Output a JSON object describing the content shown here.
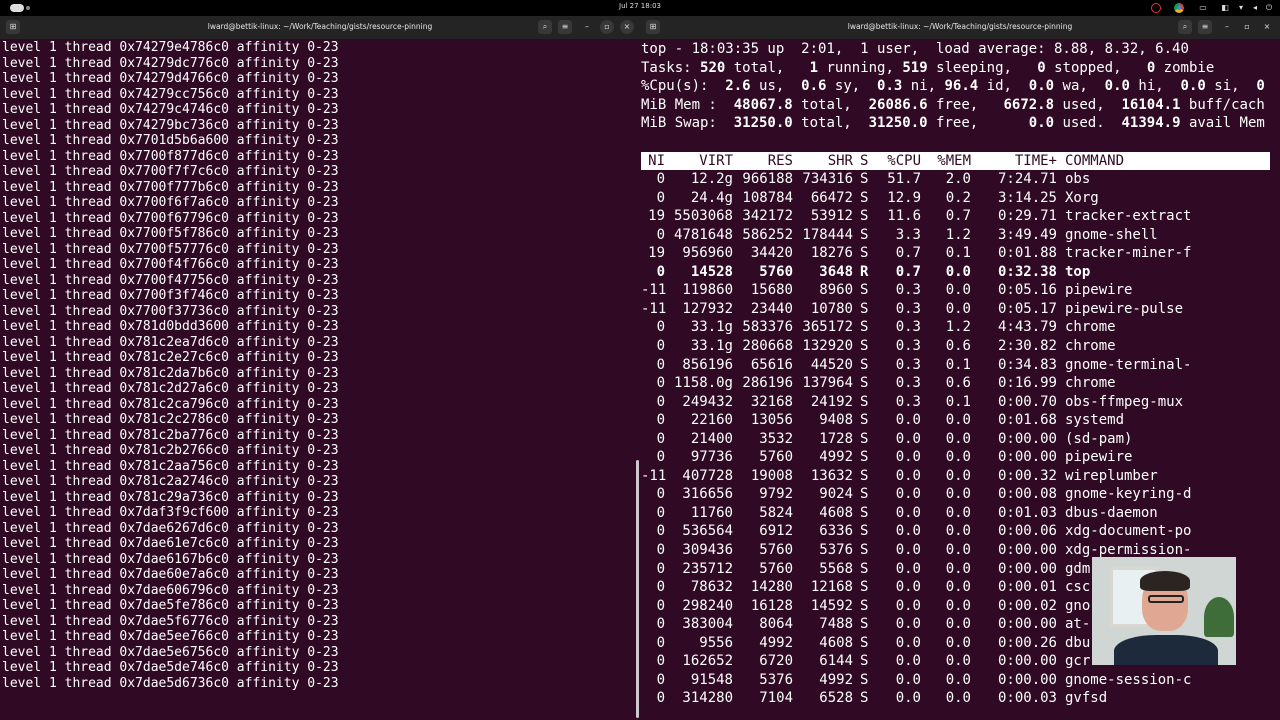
{
  "topbar": {
    "clock": "Jul 27  18:03"
  },
  "left_window": {
    "title": "lward@bettik-linux: ~/Work/Teaching/gists/resource-pinning",
    "lines": [
      "level 1 thread 0x74279e4786c0 affinity 0-23",
      "level 1 thread 0x74279dc776c0 affinity 0-23",
      "level 1 thread 0x74279d4766c0 affinity 0-23",
      "level 1 thread 0x74279cc756c0 affinity 0-23",
      "level 1 thread 0x74279c4746c0 affinity 0-23",
      "level 1 thread 0x74279bc736c0 affinity 0-23",
      "level 1 thread 0x7701d5b6a600 affinity 0-23",
      "level 1 thread 0x7700f877d6c0 affinity 0-23",
      "level 1 thread 0x7700f7f7c6c0 affinity 0-23",
      "level 1 thread 0x7700f777b6c0 affinity 0-23",
      "level 1 thread 0x7700f6f7a6c0 affinity 0-23",
      "level 1 thread 0x7700f67796c0 affinity 0-23",
      "level 1 thread 0x7700f5f786c0 affinity 0-23",
      "level 1 thread 0x7700f57776c0 affinity 0-23",
      "level 1 thread 0x7700f4f766c0 affinity 0-23",
      "level 1 thread 0x7700f47756c0 affinity 0-23",
      "level 1 thread 0x7700f3f746c0 affinity 0-23",
      "level 1 thread 0x7700f37736c0 affinity 0-23",
      "level 1 thread 0x781d0bdd3600 affinity 0-23",
      "level 1 thread 0x781c2ea7d6c0 affinity 0-23",
      "level 1 thread 0x781c2e27c6c0 affinity 0-23",
      "level 1 thread 0x781c2da7b6c0 affinity 0-23",
      "level 1 thread 0x781c2d27a6c0 affinity 0-23",
      "level 1 thread 0x781c2ca796c0 affinity 0-23",
      "level 1 thread 0x781c2c2786c0 affinity 0-23",
      "level 1 thread 0x781c2ba776c0 affinity 0-23",
      "level 1 thread 0x781c2b2766c0 affinity 0-23",
      "level 1 thread 0x781c2aa756c0 affinity 0-23",
      "level 1 thread 0x781c2a2746c0 affinity 0-23",
      "level 1 thread 0x781c29a736c0 affinity 0-23",
      "level 1 thread 0x7daf3f9cf600 affinity 0-23",
      "level 1 thread 0x7dae6267d6c0 affinity 0-23",
      "level 1 thread 0x7dae61e7c6c0 affinity 0-23",
      "level 1 thread 0x7dae6167b6c0 affinity 0-23",
      "level 1 thread 0x7dae60e7a6c0 affinity 0-23",
      "level 1 thread 0x7dae606796c0 affinity 0-23",
      "level 1 thread 0x7dae5fe786c0 affinity 0-23",
      "level 1 thread 0x7dae5f6776c0 affinity 0-23",
      "level 1 thread 0x7dae5ee766c0 affinity 0-23",
      "level 1 thread 0x7dae5e6756c0 affinity 0-23",
      "level 1 thread 0x7dae5de746c0 affinity 0-23",
      "level 1 thread 0x7dae5d6736c0 affinity 0-23"
    ]
  },
  "right_window": {
    "title": "lward@bettik-linux: ~/Work/Teaching/gists/resource-pinning",
    "summary": [
      [
        {
          "t": "top - 18:03:35 up  2:01,  1 user,  load average: 8.88, 8.32, 6.40",
          "b": false
        }
      ],
      [
        {
          "t": "Tasks: ",
          "b": false
        },
        {
          "t": "520",
          "b": true
        },
        {
          "t": " total,   ",
          "b": false
        },
        {
          "t": "1",
          "b": true
        },
        {
          "t": " running, ",
          "b": false
        },
        {
          "t": "519",
          "b": true
        },
        {
          "t": " sleeping,   ",
          "b": false
        },
        {
          "t": "0",
          "b": true
        },
        {
          "t": " stopped,   ",
          "b": false
        },
        {
          "t": "0",
          "b": true
        },
        {
          "t": " zombie",
          "b": false
        }
      ],
      [
        {
          "t": "%Cpu(s):  ",
          "b": false
        },
        {
          "t": "2.6",
          "b": true
        },
        {
          "t": " us,  ",
          "b": false
        },
        {
          "t": "0.6",
          "b": true
        },
        {
          "t": " sy,  ",
          "b": false
        },
        {
          "t": "0.3",
          "b": true
        },
        {
          "t": " ni, ",
          "b": false
        },
        {
          "t": "96.4",
          "b": true
        },
        {
          "t": " id,  ",
          "b": false
        },
        {
          "t": "0.0",
          "b": true
        },
        {
          "t": " wa,  ",
          "b": false
        },
        {
          "t": "0.0",
          "b": true
        },
        {
          "t": " hi,  ",
          "b": false
        },
        {
          "t": "0.0",
          "b": true
        },
        {
          "t": " si,  ",
          "b": false
        },
        {
          "t": "0",
          "b": true
        }
      ],
      [
        {
          "t": "MiB Mem :  ",
          "b": false
        },
        {
          "t": "48067.8",
          "b": true
        },
        {
          "t": " total,  ",
          "b": false
        },
        {
          "t": "26086.6",
          "b": true
        },
        {
          "t": " free,   ",
          "b": false
        },
        {
          "t": "6672.8",
          "b": true
        },
        {
          "t": " used,  ",
          "b": false
        },
        {
          "t": "16104.1",
          "b": true
        },
        {
          "t": " buff/cach",
          "b": false
        }
      ],
      [
        {
          "t": "MiB Swap:  ",
          "b": false
        },
        {
          "t": "31250.0",
          "b": true
        },
        {
          "t": " total,  ",
          "b": false
        },
        {
          "t": "31250.0",
          "b": true
        },
        {
          "t": " free,      ",
          "b": false
        },
        {
          "t": "0.0",
          "b": true
        },
        {
          "t": " used.  ",
          "b": false
        },
        {
          "t": "41394.9",
          "b": true
        },
        {
          "t": " avail Mem",
          "b": false
        }
      ]
    ],
    "columns": {
      "ni": "NI",
      "virt": "VIRT",
      "res": "RES",
      "shr": "SHR",
      "s": "S",
      "cpu": "%CPU",
      "mem": "%MEM",
      "time": "TIME+",
      "cmd": "COMMAND"
    },
    "processes": [
      {
        "ni": "0",
        "virt": "12.2g",
        "res": "966188",
        "shr": "734316",
        "s": "S",
        "cpu": "51.7",
        "mem": "2.0",
        "time": "7:24.71",
        "cmd": "obs"
      },
      {
        "ni": "0",
        "virt": "24.4g",
        "res": "108784",
        "shr": "66472",
        "s": "S",
        "cpu": "12.9",
        "mem": "0.2",
        "time": "3:14.25",
        "cmd": "Xorg"
      },
      {
        "ni": "19",
        "virt": "5503068",
        "res": "342172",
        "shr": "53912",
        "s": "S",
        "cpu": "11.6",
        "mem": "0.7",
        "time": "0:29.71",
        "cmd": "tracker-extract"
      },
      {
        "ni": "0",
        "virt": "4781648",
        "res": "586252",
        "shr": "178444",
        "s": "S",
        "cpu": "3.3",
        "mem": "1.2",
        "time": "3:49.49",
        "cmd": "gnome-shell"
      },
      {
        "ni": "19",
        "virt": "956960",
        "res": "34420",
        "shr": "18276",
        "s": "S",
        "cpu": "0.7",
        "mem": "0.1",
        "time": "0:01.88",
        "cmd": "tracker-miner-f"
      },
      {
        "ni": "0",
        "virt": "14528",
        "res": "5760",
        "shr": "3648",
        "s": "R",
        "cpu": "0.7",
        "mem": "0.0",
        "time": "0:32.38",
        "cmd": "top",
        "bold": true
      },
      {
        "ni": "-11",
        "virt": "119860",
        "res": "15680",
        "shr": "8960",
        "s": "S",
        "cpu": "0.3",
        "mem": "0.0",
        "time": "0:05.16",
        "cmd": "pipewire"
      },
      {
        "ni": "-11",
        "virt": "127932",
        "res": "23440",
        "shr": "10780",
        "s": "S",
        "cpu": "0.3",
        "mem": "0.0",
        "time": "0:05.17",
        "cmd": "pipewire-pulse"
      },
      {
        "ni": "0",
        "virt": "33.1g",
        "res": "583376",
        "shr": "365172",
        "s": "S",
        "cpu": "0.3",
        "mem": "1.2",
        "time": "4:43.79",
        "cmd": "chrome"
      },
      {
        "ni": "0",
        "virt": "33.1g",
        "res": "280668",
        "shr": "132920",
        "s": "S",
        "cpu": "0.3",
        "mem": "0.6",
        "time": "2:30.82",
        "cmd": "chrome"
      },
      {
        "ni": "0",
        "virt": "856196",
        "res": "65616",
        "shr": "44520",
        "s": "S",
        "cpu": "0.3",
        "mem": "0.1",
        "time": "0:34.83",
        "cmd": "gnome-terminal-"
      },
      {
        "ni": "0",
        "virt": "1158.0g",
        "res": "286196",
        "shr": "137964",
        "s": "S",
        "cpu": "0.3",
        "mem": "0.6",
        "time": "0:16.99",
        "cmd": "chrome"
      },
      {
        "ni": "0",
        "virt": "249432",
        "res": "32168",
        "shr": "24192",
        "s": "S",
        "cpu": "0.3",
        "mem": "0.1",
        "time": "0:00.70",
        "cmd": "obs-ffmpeg-mux"
      },
      {
        "ni": "0",
        "virt": "22160",
        "res": "13056",
        "shr": "9408",
        "s": "S",
        "cpu": "0.0",
        "mem": "0.0",
        "time": "0:01.68",
        "cmd": "systemd"
      },
      {
        "ni": "0",
        "virt": "21400",
        "res": "3532",
        "shr": "1728",
        "s": "S",
        "cpu": "0.0",
        "mem": "0.0",
        "time": "0:00.00",
        "cmd": "(sd-pam)"
      },
      {
        "ni": "0",
        "virt": "97736",
        "res": "5760",
        "shr": "4992",
        "s": "S",
        "cpu": "0.0",
        "mem": "0.0",
        "time": "0:00.00",
        "cmd": "pipewire"
      },
      {
        "ni": "-11",
        "virt": "407728",
        "res": "19008",
        "shr": "13632",
        "s": "S",
        "cpu": "0.0",
        "mem": "0.0",
        "time": "0:00.32",
        "cmd": "wireplumber"
      },
      {
        "ni": "0",
        "virt": "316656",
        "res": "9792",
        "shr": "9024",
        "s": "S",
        "cpu": "0.0",
        "mem": "0.0",
        "time": "0:00.08",
        "cmd": "gnome-keyring-d"
      },
      {
        "ni": "0",
        "virt": "11760",
        "res": "5824",
        "shr": "4608",
        "s": "S",
        "cpu": "0.0",
        "mem": "0.0",
        "time": "0:01.03",
        "cmd": "dbus-daemon"
      },
      {
        "ni": "0",
        "virt": "536564",
        "res": "6912",
        "shr": "6336",
        "s": "S",
        "cpu": "0.0",
        "mem": "0.0",
        "time": "0:00.06",
        "cmd": "xdg-document-po"
      },
      {
        "ni": "0",
        "virt": "309436",
        "res": "5760",
        "shr": "5376",
        "s": "S",
        "cpu": "0.0",
        "mem": "0.0",
        "time": "0:00.00",
        "cmd": "xdg-permission-"
      },
      {
        "ni": "0",
        "virt": "235712",
        "res": "5760",
        "shr": "5568",
        "s": "S",
        "cpu": "0.0",
        "mem": "0.0",
        "time": "0:00.00",
        "cmd": "gdm"
      },
      {
        "ni": "0",
        "virt": "78632",
        "res": "14280",
        "shr": "12168",
        "s": "S",
        "cpu": "0.0",
        "mem": "0.0",
        "time": "0:00.01",
        "cmd": "csc"
      },
      {
        "ni": "0",
        "virt": "298240",
        "res": "16128",
        "shr": "14592",
        "s": "S",
        "cpu": "0.0",
        "mem": "0.0",
        "time": "0:00.02",
        "cmd": "gno"
      },
      {
        "ni": "0",
        "virt": "383004",
        "res": "8064",
        "shr": "7488",
        "s": "S",
        "cpu": "0.0",
        "mem": "0.0",
        "time": "0:00.00",
        "cmd": "at-"
      },
      {
        "ni": "0",
        "virt": "9556",
        "res": "4992",
        "shr": "4608",
        "s": "S",
        "cpu": "0.0",
        "mem": "0.0",
        "time": "0:00.26",
        "cmd": "dbu"
      },
      {
        "ni": "0",
        "virt": "162652",
        "res": "6720",
        "shr": "6144",
        "s": "S",
        "cpu": "0.0",
        "mem": "0.0",
        "time": "0:00.00",
        "cmd": "gcr"
      },
      {
        "ni": "0",
        "virt": "91548",
        "res": "5376",
        "shr": "4992",
        "s": "S",
        "cpu": "0.0",
        "mem": "0.0",
        "time": "0:00.00",
        "cmd": "gnome-session-c"
      },
      {
        "ni": "0",
        "virt": "314280",
        "res": "7104",
        "shr": "6528",
        "s": "S",
        "cpu": "0.0",
        "mem": "0.0",
        "time": "0:00.03",
        "cmd": "gvfsd"
      }
    ]
  },
  "icons": {
    "new_tab": "terminal-new-tab-icon",
    "search": "search-icon",
    "menu": "hamburger-menu-icon",
    "minimize": "minimize-icon",
    "maximize": "maximize-icon",
    "close": "close-icon"
  },
  "colors": {
    "terminal_bg": "#300a24",
    "header_bg": "#242424",
    "text": "#ffffff"
  }
}
